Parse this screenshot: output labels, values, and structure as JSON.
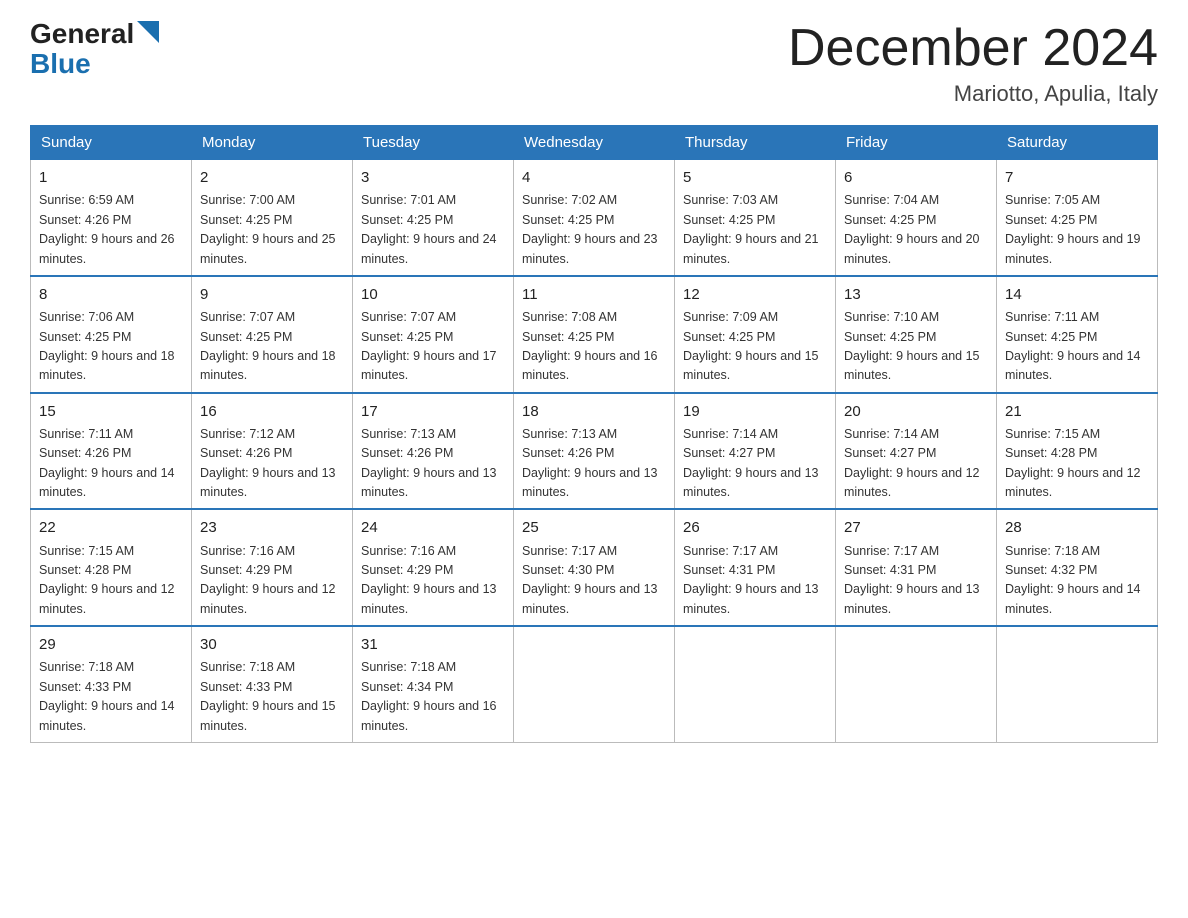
{
  "header": {
    "logo_line1": "General",
    "logo_line2": "Blue",
    "month_title": "December 2024",
    "location": "Mariotto, Apulia, Italy"
  },
  "weekdays": [
    "Sunday",
    "Monday",
    "Tuesday",
    "Wednesday",
    "Thursday",
    "Friday",
    "Saturday"
  ],
  "weeks": [
    [
      {
        "day": "1",
        "sunrise": "Sunrise: 6:59 AM",
        "sunset": "Sunset: 4:26 PM",
        "daylight": "Daylight: 9 hours and 26 minutes."
      },
      {
        "day": "2",
        "sunrise": "Sunrise: 7:00 AM",
        "sunset": "Sunset: 4:25 PM",
        "daylight": "Daylight: 9 hours and 25 minutes."
      },
      {
        "day": "3",
        "sunrise": "Sunrise: 7:01 AM",
        "sunset": "Sunset: 4:25 PM",
        "daylight": "Daylight: 9 hours and 24 minutes."
      },
      {
        "day": "4",
        "sunrise": "Sunrise: 7:02 AM",
        "sunset": "Sunset: 4:25 PM",
        "daylight": "Daylight: 9 hours and 23 minutes."
      },
      {
        "day": "5",
        "sunrise": "Sunrise: 7:03 AM",
        "sunset": "Sunset: 4:25 PM",
        "daylight": "Daylight: 9 hours and 21 minutes."
      },
      {
        "day": "6",
        "sunrise": "Sunrise: 7:04 AM",
        "sunset": "Sunset: 4:25 PM",
        "daylight": "Daylight: 9 hours and 20 minutes."
      },
      {
        "day": "7",
        "sunrise": "Sunrise: 7:05 AM",
        "sunset": "Sunset: 4:25 PM",
        "daylight": "Daylight: 9 hours and 19 minutes."
      }
    ],
    [
      {
        "day": "8",
        "sunrise": "Sunrise: 7:06 AM",
        "sunset": "Sunset: 4:25 PM",
        "daylight": "Daylight: 9 hours and 18 minutes."
      },
      {
        "day": "9",
        "sunrise": "Sunrise: 7:07 AM",
        "sunset": "Sunset: 4:25 PM",
        "daylight": "Daylight: 9 hours and 18 minutes."
      },
      {
        "day": "10",
        "sunrise": "Sunrise: 7:07 AM",
        "sunset": "Sunset: 4:25 PM",
        "daylight": "Daylight: 9 hours and 17 minutes."
      },
      {
        "day": "11",
        "sunrise": "Sunrise: 7:08 AM",
        "sunset": "Sunset: 4:25 PM",
        "daylight": "Daylight: 9 hours and 16 minutes."
      },
      {
        "day": "12",
        "sunrise": "Sunrise: 7:09 AM",
        "sunset": "Sunset: 4:25 PM",
        "daylight": "Daylight: 9 hours and 15 minutes."
      },
      {
        "day": "13",
        "sunrise": "Sunrise: 7:10 AM",
        "sunset": "Sunset: 4:25 PM",
        "daylight": "Daylight: 9 hours and 15 minutes."
      },
      {
        "day": "14",
        "sunrise": "Sunrise: 7:11 AM",
        "sunset": "Sunset: 4:25 PM",
        "daylight": "Daylight: 9 hours and 14 minutes."
      }
    ],
    [
      {
        "day": "15",
        "sunrise": "Sunrise: 7:11 AM",
        "sunset": "Sunset: 4:26 PM",
        "daylight": "Daylight: 9 hours and 14 minutes."
      },
      {
        "day": "16",
        "sunrise": "Sunrise: 7:12 AM",
        "sunset": "Sunset: 4:26 PM",
        "daylight": "Daylight: 9 hours and 13 minutes."
      },
      {
        "day": "17",
        "sunrise": "Sunrise: 7:13 AM",
        "sunset": "Sunset: 4:26 PM",
        "daylight": "Daylight: 9 hours and 13 minutes."
      },
      {
        "day": "18",
        "sunrise": "Sunrise: 7:13 AM",
        "sunset": "Sunset: 4:26 PM",
        "daylight": "Daylight: 9 hours and 13 minutes."
      },
      {
        "day": "19",
        "sunrise": "Sunrise: 7:14 AM",
        "sunset": "Sunset: 4:27 PM",
        "daylight": "Daylight: 9 hours and 13 minutes."
      },
      {
        "day": "20",
        "sunrise": "Sunrise: 7:14 AM",
        "sunset": "Sunset: 4:27 PM",
        "daylight": "Daylight: 9 hours and 12 minutes."
      },
      {
        "day": "21",
        "sunrise": "Sunrise: 7:15 AM",
        "sunset": "Sunset: 4:28 PM",
        "daylight": "Daylight: 9 hours and 12 minutes."
      }
    ],
    [
      {
        "day": "22",
        "sunrise": "Sunrise: 7:15 AM",
        "sunset": "Sunset: 4:28 PM",
        "daylight": "Daylight: 9 hours and 12 minutes."
      },
      {
        "day": "23",
        "sunrise": "Sunrise: 7:16 AM",
        "sunset": "Sunset: 4:29 PM",
        "daylight": "Daylight: 9 hours and 12 minutes."
      },
      {
        "day": "24",
        "sunrise": "Sunrise: 7:16 AM",
        "sunset": "Sunset: 4:29 PM",
        "daylight": "Daylight: 9 hours and 13 minutes."
      },
      {
        "day": "25",
        "sunrise": "Sunrise: 7:17 AM",
        "sunset": "Sunset: 4:30 PM",
        "daylight": "Daylight: 9 hours and 13 minutes."
      },
      {
        "day": "26",
        "sunrise": "Sunrise: 7:17 AM",
        "sunset": "Sunset: 4:31 PM",
        "daylight": "Daylight: 9 hours and 13 minutes."
      },
      {
        "day": "27",
        "sunrise": "Sunrise: 7:17 AM",
        "sunset": "Sunset: 4:31 PM",
        "daylight": "Daylight: 9 hours and 13 minutes."
      },
      {
        "day": "28",
        "sunrise": "Sunrise: 7:18 AM",
        "sunset": "Sunset: 4:32 PM",
        "daylight": "Daylight: 9 hours and 14 minutes."
      }
    ],
    [
      {
        "day": "29",
        "sunrise": "Sunrise: 7:18 AM",
        "sunset": "Sunset: 4:33 PM",
        "daylight": "Daylight: 9 hours and 14 minutes."
      },
      {
        "day": "30",
        "sunrise": "Sunrise: 7:18 AM",
        "sunset": "Sunset: 4:33 PM",
        "daylight": "Daylight: 9 hours and 15 minutes."
      },
      {
        "day": "31",
        "sunrise": "Sunrise: 7:18 AM",
        "sunset": "Sunset: 4:34 PM",
        "daylight": "Daylight: 9 hours and 16 minutes."
      },
      null,
      null,
      null,
      null
    ]
  ]
}
